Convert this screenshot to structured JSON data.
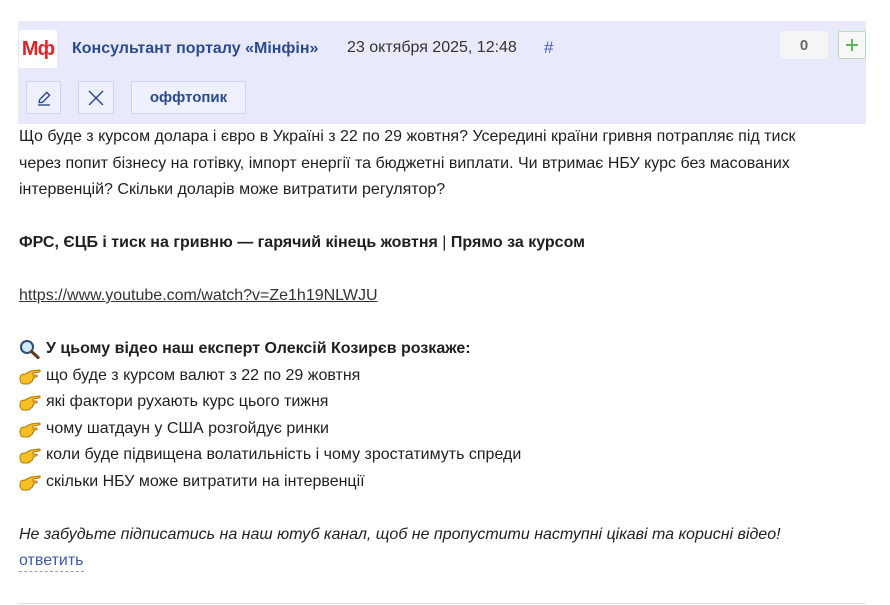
{
  "post": {
    "avatar_text": "Мф",
    "author": "Консультант порталу «Мінфін»",
    "date": "23 октября 2025, 12:48",
    "anchor": "#",
    "score": "0",
    "tag": "оффтопик",
    "icons": {
      "edit": "pencil-icon",
      "delete": "close-icon",
      "upvote": "plus-icon"
    },
    "colors": {
      "header_bg": "#e8eafc",
      "author": "#2c4a8e",
      "brand_red": "#d8262a",
      "plus": "#5cb85c"
    }
  },
  "body": {
    "intro_line1": "Що буде з курсом долара і євро в Україні з 22 по 29 жовтня? Усередині країни гривня потрапляє під тиск",
    "intro_line2": "через попит бізнесу на готівку, імпорт енергії та бюджетні виплати. Чи втримає НБУ курс без масованих",
    "intro_line3": "інтервенцій? Скільки доларів може витратити регулятор?",
    "video_title_a": "ФРС, ЄЦБ і тиск на гривню — гарячий кінець жовтня",
    "video_title_sep": " | ",
    "video_title_b": "Прямо за курсом",
    "link": "https://www.youtube.com/watch?v=Ze1h19NLWJU",
    "list_heading": "У цьому відео наш експерт Олексій Козирєв розкаже:",
    "list_items": [
      "що буде з курсом валют з 22 по 29 жовтня",
      "які фактори рухають курс цього тижня",
      "чому шатдаун у США розгойдує ринки",
      "коли буде підвищена волатильність і чому зростатимуть спреди",
      "скільки НБУ може витратити на інтервенції"
    ],
    "closing": "Не забудьте підписатись на наш ютуб канал, щоб не пропустити наступні цікаві та корисні відео!"
  },
  "actions": {
    "reply": "ответить"
  }
}
